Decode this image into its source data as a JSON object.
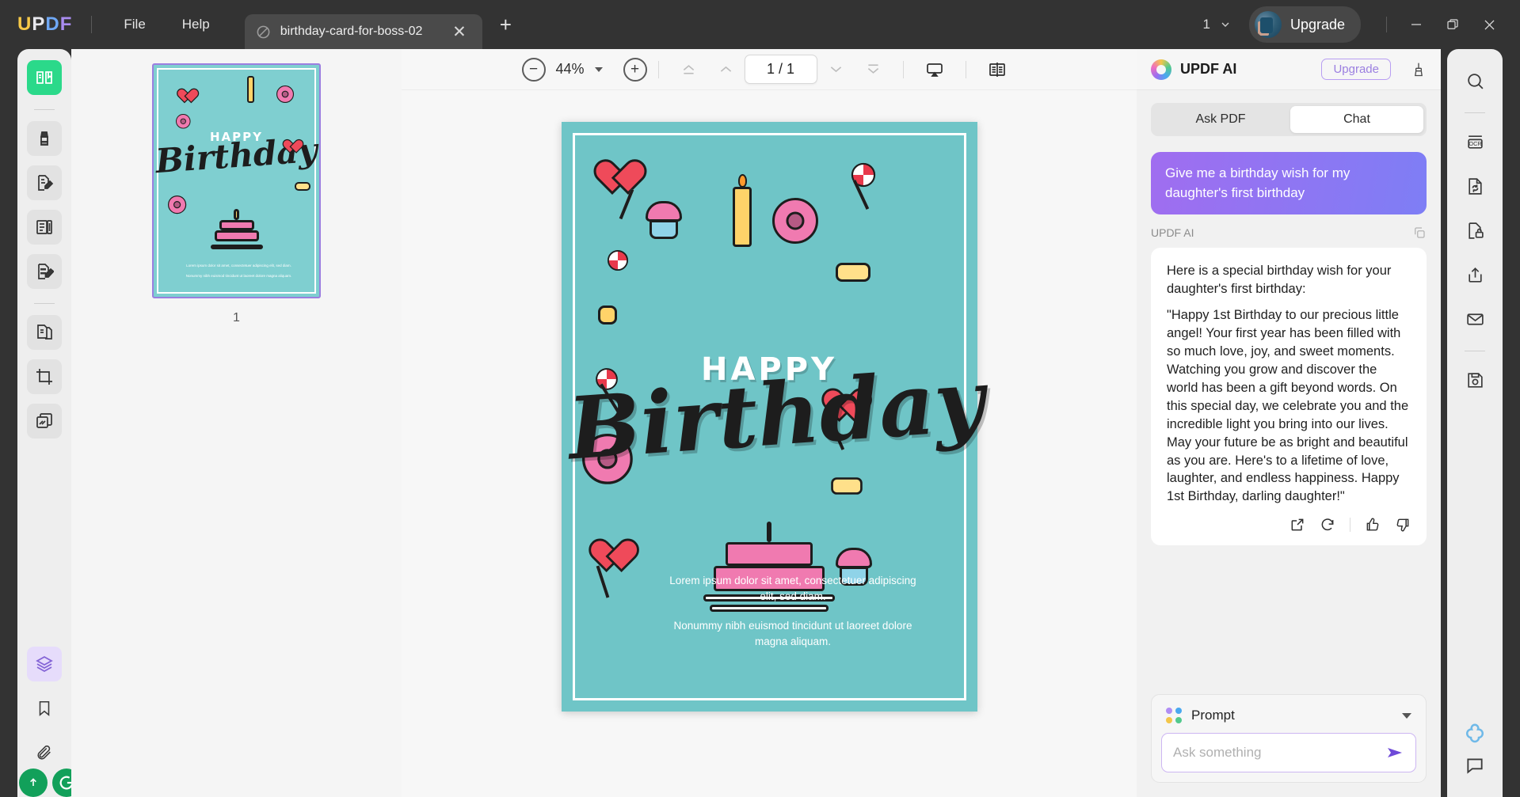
{
  "titlebar": {
    "logo_letters": [
      "U",
      "P",
      "D",
      "F"
    ],
    "menu": [
      {
        "label": "File",
        "name": "menu-file"
      },
      {
        "label": "Help",
        "name": "menu-help"
      }
    ],
    "tab": {
      "title": "birthday-card-for-boss-02",
      "close": "✕"
    },
    "new_tab": "+",
    "window_count": "1",
    "upgrade_label": "Upgrade",
    "window_controls": {
      "minimize": "—",
      "maximize": "❐",
      "close": "✕"
    }
  },
  "left_rail": {
    "items": [
      {
        "name": "sidebar-item-reader",
        "icon": "book-reader-icon",
        "state": "active-green"
      },
      {
        "name": "sidebar-item-highlight",
        "icon": "highlighter-icon",
        "state": "normal"
      },
      {
        "name": "sidebar-item-edit-pdf",
        "icon": "edit-document-icon",
        "state": "normal"
      },
      {
        "name": "sidebar-item-organize",
        "icon": "page-organize-icon",
        "state": "normal"
      },
      {
        "name": "sidebar-item-fill-sign",
        "icon": "fill-sign-icon",
        "state": "normal"
      },
      {
        "name": "sidebar-item-compare",
        "icon": "compare-documents-icon",
        "state": "normal"
      },
      {
        "name": "sidebar-item-crop",
        "icon": "crop-icon",
        "state": "normal"
      },
      {
        "name": "sidebar-item-batch",
        "icon": "batch-pages-icon",
        "state": "normal"
      },
      {
        "name": "sidebar-item-layers",
        "icon": "layers-icon",
        "state": "active-purple"
      },
      {
        "name": "sidebar-item-bookmark",
        "icon": "bookmark-icon",
        "state": "plain"
      },
      {
        "name": "sidebar-item-attachment",
        "icon": "paperclip-icon",
        "state": "plain"
      }
    ]
  },
  "right_rail": {
    "items": [
      {
        "name": "tool-search",
        "icon": "search-icon"
      },
      {
        "name": "tool-ocr",
        "icon": "ocr-icon"
      },
      {
        "name": "tool-convert",
        "icon": "convert-document-icon"
      },
      {
        "name": "tool-protect",
        "icon": "lock-document-icon"
      },
      {
        "name": "tool-share",
        "icon": "share-upload-icon"
      },
      {
        "name": "tool-email",
        "icon": "envelope-icon"
      },
      {
        "name": "tool-save",
        "icon": "save-disk-icon"
      }
    ]
  },
  "thumbnails": {
    "pages": [
      {
        "label": "1",
        "selected": true
      }
    ]
  },
  "viewer_toolbar": {
    "zoom_out": "−",
    "zoom_value": "44%",
    "zoom_in": "+",
    "page_indicator": "1 / 1",
    "first_page": "first-page-icon",
    "prev_page": "previous-page-icon",
    "next_page": "next-page-icon",
    "last_page": "last-page-icon",
    "presentation": "presentation-mode-icon",
    "layout": "page-layout-icon"
  },
  "document": {
    "heading_small": "HAPPY",
    "heading_script": "Birthday",
    "body_paragraphs": [
      "Lorem ipsum dolor sit amet, consectetuer adipiscing elit, sed diam.",
      "Nonummy nibh euismod tincidunt ut laoreet dolore magna aliquam."
    ],
    "background_color": "#6fc5c7",
    "accent_pink": "#f07ab0",
    "accent_red": "#ef4a5a",
    "accent_yellow": "#ffd369"
  },
  "ai_panel": {
    "title": "UPDF AI",
    "upgrade_label": "Upgrade",
    "clear_icon": "broom-icon",
    "tabs": [
      {
        "label": "Ask PDF",
        "selected": false,
        "name": "tab-ask-pdf"
      },
      {
        "label": "Chat",
        "selected": true,
        "name": "tab-chat"
      }
    ],
    "user_message": "Give me a birthday wish for my daughter's first birthday",
    "assistant_label": "UPDF AI",
    "assistant_paragraphs": [
      "Here is a special birthday wish for your daughter's first birthday:",
      "\"Happy 1st Birthday to our precious little angel! Your first year has been filled with so much love, joy, and sweet moments. Watching you grow and discover the world has been a gift beyond words. On this special day, we celebrate you and the incredible light you bring into our lives. May your future be as bright and beautiful as you are. Here's to a lifetime of love, laughter, and endless happiness. Happy 1st Birthday, darling daughter!\""
    ],
    "actions": [
      {
        "name": "open-external-button",
        "icon": "external-link-icon"
      },
      {
        "name": "regenerate-button",
        "icon": "refresh-icon"
      },
      {
        "name": "thumbs-up-button",
        "icon": "thumbs-up-icon"
      },
      {
        "name": "thumbs-down-button",
        "icon": "thumbs-down-icon"
      }
    ],
    "prompt_selector_label": "Prompt",
    "prompt_dot_colors": [
      "#b08ef5",
      "#4aa8f0",
      "#f3c64a",
      "#52c98d"
    ],
    "ask_placeholder": "Ask something",
    "ask_value": "",
    "send_icon": "send-icon",
    "accent_purple": "#8464d6"
  },
  "float_buttons": [
    {
      "name": "ai-assistant-float-button",
      "icon": "ai-flower-icon"
    },
    {
      "name": "comment-float-button",
      "icon": "comment-icon"
    }
  ]
}
